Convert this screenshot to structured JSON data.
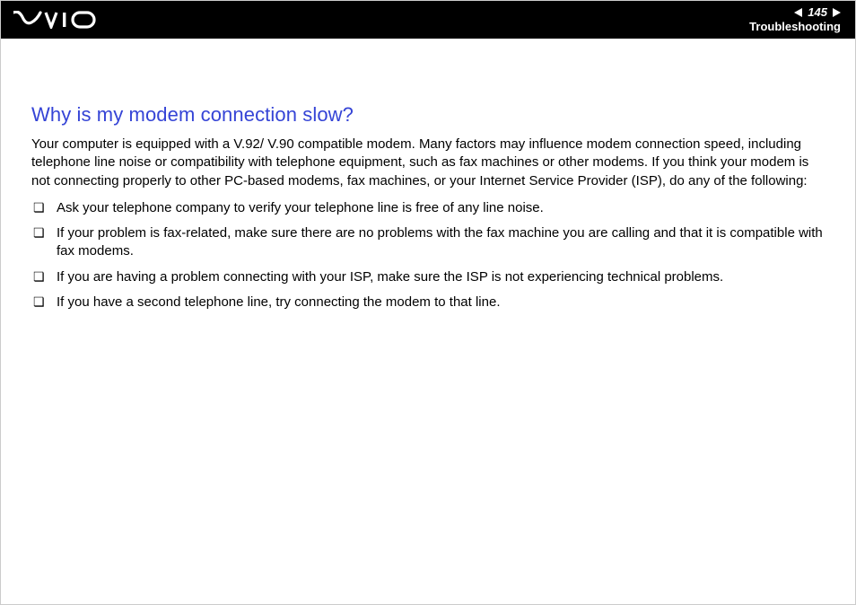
{
  "header": {
    "page_number": "145",
    "section": "Troubleshooting"
  },
  "main": {
    "title": "Why is my modem connection slow?",
    "intro": "Your computer is equipped with a V.92/ V.90 compatible modem. Many factors may influence modem connection speed, including telephone line noise or compatibility with telephone equipment, such as fax machines or other modems. If you think your modem is not connecting properly to other PC-based modems, fax machines, or your Internet Service Provider (ISP), do any of the following:",
    "bullets": [
      "Ask your telephone company to verify your telephone line is free of any line noise.",
      "If your problem is fax-related, make sure there are no problems with the fax machine you are calling and that it is compatible with fax modems.",
      "If you are having a problem connecting with your ISP, make sure the ISP is not experiencing technical problems.",
      "If you have a second telephone line, try connecting the modem to that line."
    ]
  }
}
